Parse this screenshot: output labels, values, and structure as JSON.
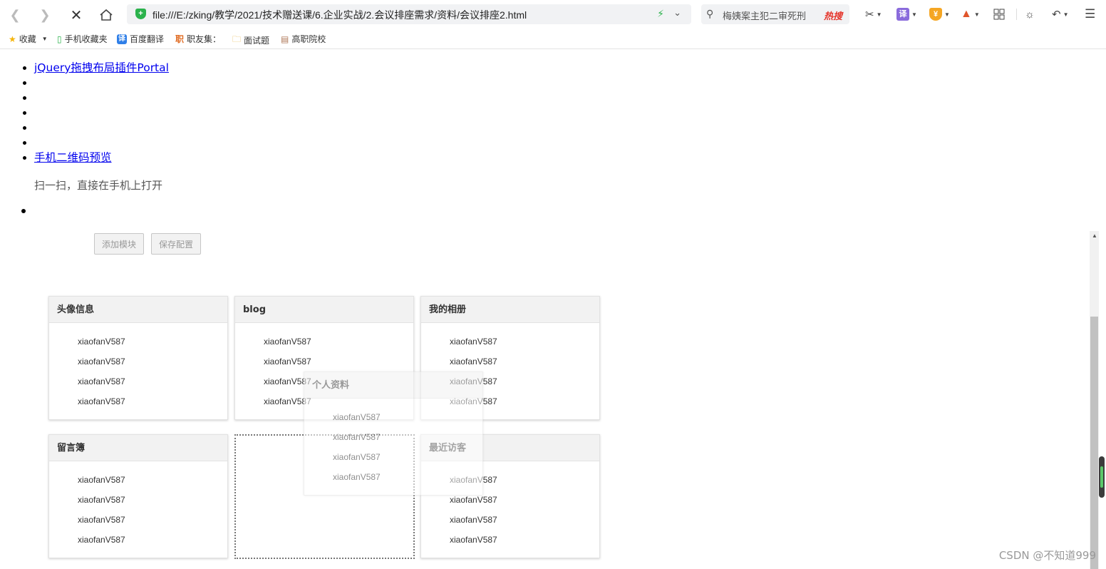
{
  "browser": {
    "url": "file:///E:/zking/教学/2021/技术赠送课/6.企业实战/2.会议排座需求/资料/会议排座2.html",
    "search_text": "梅姨案主犯二审死刑",
    "search_badge": "热搜"
  },
  "bookmarks": [
    {
      "label": "收藏",
      "icon": "star-icon"
    },
    {
      "label": "手机收藏夹",
      "icon": "phone-icon"
    },
    {
      "label": "百度翻译",
      "icon": "translate-icon"
    },
    {
      "label": "职友集：",
      "icon": "jobui-icon"
    },
    {
      "label": "面试题",
      "icon": "folder-icon"
    },
    {
      "label": "高职院校",
      "icon": "book-icon"
    }
  ],
  "nav": {
    "link_portal": "jQuery拖拽布局插件Portal",
    "link_qr": "手机二维码预览",
    "qr_tip": "扫一扫，直接在手机上打开"
  },
  "buttons": {
    "add_module": "添加模块",
    "save_config": "保存配置"
  },
  "panels": [
    {
      "title": "头像信息",
      "rows": [
        "xiaofanV587",
        "xiaofanV587",
        "xiaofanV587",
        "xiaofanV587"
      ]
    },
    {
      "title": "blog",
      "rows": [
        "xiaofanV587",
        "xiaofanV587",
        "xiaofanV587",
        "xiaofanV587"
      ]
    },
    {
      "title": "我的相册",
      "rows": [
        "xiaofanV587",
        "xiaofanV587",
        "xiaofanV587",
        "xiaofanV587"
      ]
    },
    {
      "title": "留言簿",
      "rows": [
        "xiaofanV587",
        "xiaofanV587",
        "xiaofanV587",
        "xiaofanV587"
      ]
    },
    {
      "title": "最近访客",
      "rows": [
        "xiaofanV587",
        "xiaofanV587",
        "xiaofanV587",
        "xiaofanV587"
      ]
    }
  ],
  "dragging_panel": {
    "title": "个人资料",
    "rows": [
      "xiaofanV587",
      "xiaofanV587",
      "xiaofanV587",
      "xiaofanV587"
    ]
  },
  "watermark": "CSDN @不知道999"
}
